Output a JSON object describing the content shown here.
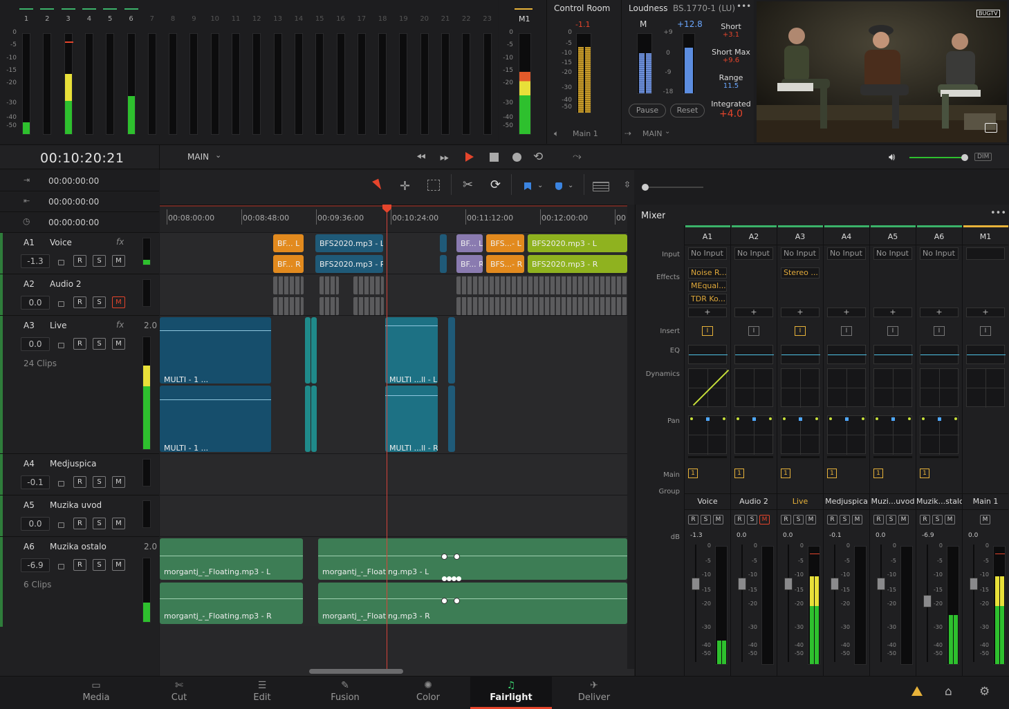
{
  "meters_top": {
    "channels": [
      "1",
      "2",
      "3",
      "4",
      "5",
      "6",
      "7",
      "8",
      "9",
      "10",
      "11",
      "12",
      "13",
      "14",
      "15",
      "16",
      "17",
      "18",
      "19",
      "20",
      "21",
      "22",
      "23"
    ],
    "scale": [
      "0",
      "-5",
      "-10",
      "-15",
      "-20",
      "-30",
      "-40",
      "-50"
    ],
    "levels": [
      0.12,
      0,
      0.6,
      0,
      0,
      0.38,
      0,
      0,
      0,
      0,
      0,
      0,
      0,
      0,
      0,
      0,
      0,
      0,
      0,
      0,
      0,
      0,
      0
    ],
    "bus_label": "M1",
    "bus_level": 0.62
  },
  "control_room": {
    "title": "Control Room",
    "peak": "-1.1",
    "scale": [
      "0",
      "-5",
      "-10",
      "-15",
      "-20",
      "-30",
      "-40",
      "-50"
    ],
    "footer_left": "Main 1",
    "footer_right": "MAIN"
  },
  "loudness": {
    "title": "Loudness",
    "standard": "BS.1770-1 (LU)",
    "menu": "•••",
    "m_label": "M",
    "m_value": "+12.8",
    "scale": [
      "+9",
      "0",
      "-9",
      "-18"
    ],
    "short_label": "Short",
    "short_value": "+3.1",
    "shortmax_label": "Short Max",
    "shortmax_value": "+9.6",
    "range_label": "Range",
    "range_value": "11.5",
    "integrated_label": "Integrated",
    "integrated_value": "+4.0",
    "pause": "Pause",
    "reset": "Reset"
  },
  "viewer": {
    "watermark": "BUGTV"
  },
  "transport": {
    "timecode": "00:10:20:21",
    "timeline_name": "MAIN"
  },
  "markers": {
    "in": "00:00:00:00",
    "out": "00:00:00:00",
    "duration": "00:00:00:00"
  },
  "ruler": [
    "00:08:00:00",
    "00:08:48:00",
    "00:09:36:00",
    "00:10:24:00",
    "00:11:12:00",
    "00:12:00:00",
    "00"
  ],
  "tracks": [
    {
      "id": "A1",
      "name": "Voice",
      "fx": "fx",
      "level": "-1.3",
      "mute_active": false,
      "extra": "",
      "clips_info": ""
    },
    {
      "id": "A2",
      "name": "Audio 2",
      "fx": "",
      "level": "0.0",
      "mute_active": true,
      "extra": "",
      "clips_info": ""
    },
    {
      "id": "A3",
      "name": "Live",
      "fx": "fx",
      "level": "0.0",
      "mute_active": false,
      "extra": "2.0",
      "clips_info": "24 Clips"
    },
    {
      "id": "A4",
      "name": "Medjuspica",
      "fx": "",
      "level": "-0.1",
      "mute_active": false,
      "extra": "",
      "clips_info": ""
    },
    {
      "id": "A5",
      "name": "Muzika uvod",
      "fx": "",
      "level": "0.0",
      "mute_active": false,
      "extra": "",
      "clips_info": ""
    },
    {
      "id": "A6",
      "name": "Muzika ostalo",
      "fx": "",
      "level": "-6.9",
      "mute_active": false,
      "extra": "2.0",
      "clips_info": "6 Clips"
    }
  ],
  "btn_labels": {
    "r": "R",
    "s": "S",
    "m": "M"
  },
  "clips": {
    "bf_l": "BF... L",
    "bf_r": "BF... R",
    "bfs_l": "BFS2020.mp3 - L",
    "bfs_r": "BFS2020.mp3 - R",
    "bfs_short_l": "BFS...- L",
    "bfs_short_r": "BFS...- R",
    "multi1": "MULTI - 1 ...",
    "multi2": "MULTI - 1 ...",
    "multi_l": "MULTI ...ll - L",
    "multi_r": "MULTI ...ll - R",
    "morg1_l": "morgantj_-_Floating.mp3 - L",
    "morg1_r": "morgantj_-_Floating.mp3 - R",
    "morg2_l": "morgantj_-_Floating.mp3 - L",
    "morg2_r": "morgantj_-_Floating.mp3 - R"
  },
  "mixer": {
    "title": "Mixer",
    "menu": "•••",
    "rows": {
      "input": "Input",
      "effects": "Effects",
      "insert": "Insert",
      "eq": "EQ",
      "dynamics": "Dynamics",
      "pan": "Pan",
      "main": "Main",
      "group": "Group",
      "db": "dB"
    },
    "channels": [
      {
        "id": "A1",
        "input": "No Input",
        "effects": [
          "Noise R...",
          "MEqual...",
          "TDR Ko..."
        ],
        "name": "Voice",
        "db": "-1.3",
        "main": "1"
      },
      {
        "id": "A2",
        "input": "No Input",
        "effects": [],
        "name": "Audio 2",
        "db": "0.0",
        "main": "1"
      },
      {
        "id": "A3",
        "input": "No Input",
        "effects": [
          "Stereo ..."
        ],
        "name": "Live",
        "db": "0.0",
        "main": "1"
      },
      {
        "id": "A4",
        "input": "No Input",
        "effects": [],
        "name": "Medjuspica",
        "db": "-0.1",
        "main": "1"
      },
      {
        "id": "A5",
        "input": "No Input",
        "effects": [],
        "name": "Muzi...uvod",
        "db": "0.0",
        "main": "1"
      },
      {
        "id": "A6",
        "input": "No Input",
        "effects": [],
        "name": "Muzik...stalo",
        "db": "-6.9",
        "main": "1"
      },
      {
        "id": "M1",
        "input": "",
        "effects": [],
        "name": "Main 1",
        "db": "0.0",
        "main": ""
      }
    ],
    "fader_scale": [
      "0",
      "-5",
      "-10",
      "-15",
      "-20",
      "-30",
      "-40",
      "-50"
    ],
    "plus": "+",
    "insert_btn": "I"
  },
  "nav": [
    {
      "label": "Media",
      "icon": "media-icon"
    },
    {
      "label": "Cut",
      "icon": "cut-icon"
    },
    {
      "label": "Edit",
      "icon": "edit-icon"
    },
    {
      "label": "Fusion",
      "icon": "fusion-icon"
    },
    {
      "label": "Color",
      "icon": "color-icon"
    },
    {
      "label": "Fairlight",
      "icon": "fairlight-icon"
    },
    {
      "label": "Deliver",
      "icon": "deliver-icon"
    }
  ],
  "dim": "DIM",
  "colors": {
    "accent": "#e8b33a",
    "red": "#e5452c",
    "teal": "#1f5a78",
    "green": "#3d7d55",
    "orange": "#e28a1e",
    "lime": "#8fb21f",
    "purple": "#8a7bb0"
  }
}
